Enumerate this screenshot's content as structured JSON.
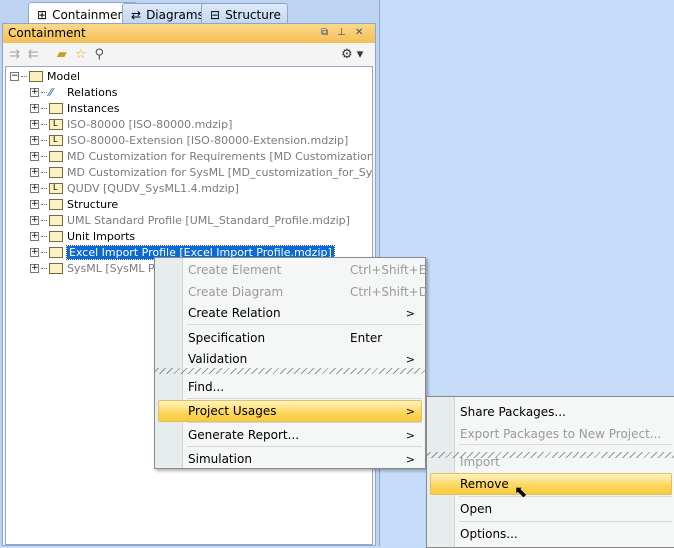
{
  "tabs": [
    {
      "label": "Containment",
      "icon": "containment-icon"
    },
    {
      "label": "Diagrams",
      "icon": "diagrams-icon"
    },
    {
      "label": "Structure",
      "icon": "structure-icon"
    }
  ],
  "panel": {
    "title": "Containment"
  },
  "tree": [
    {
      "label": "Model",
      "type": "model",
      "expanded": true,
      "level": 0
    },
    {
      "label": "Relations",
      "type": "relations",
      "level": 1
    },
    {
      "label": "Instances",
      "type": "folder",
      "level": 1
    },
    {
      "label": "ISO-80000 [ISO-80000.mdzip]",
      "type": "library",
      "level": 1,
      "gray": true
    },
    {
      "label": "ISO-80000-Extension [ISO-80000-Extension.mdzip]",
      "type": "library",
      "level": 1,
      "gray": true
    },
    {
      "label": "MD Customization for Requirements [MD Customization for Requ",
      "type": "shared",
      "level": 1,
      "gray": true
    },
    {
      "label": "MD Customization for SysML [MD_customization_for_SysML.mdzi",
      "type": "shared",
      "level": 1,
      "gray": true
    },
    {
      "label": "QUDV [QUDV_SysML1.4.mdzip]",
      "type": "library",
      "level": 1,
      "gray": true
    },
    {
      "label": "Structure",
      "type": "folder",
      "level": 1
    },
    {
      "label": "UML Standard Profile [UML_Standard_Profile.mdzip]",
      "type": "shared",
      "level": 1,
      "gray": true
    },
    {
      "label": "Unit Imports",
      "type": "folder",
      "level": 1
    },
    {
      "label": "Excel Import Profile [Excel Import Profile.mdzip]",
      "type": "profile",
      "level": 1,
      "selected": true
    },
    {
      "label": "SysML [SysML Profi",
      "type": "profile",
      "level": 1,
      "gray": true
    }
  ],
  "context_menu": [
    {
      "label": "Create Element",
      "shortcut": "Ctrl+Shift+E",
      "disabled": true
    },
    {
      "label": "Create Diagram",
      "shortcut": "Ctrl+Shift+D",
      "disabled": true
    },
    {
      "label": "Create Relation",
      "submenu": true
    },
    {
      "label": "Specification",
      "shortcut": "Enter"
    },
    {
      "label": "Validation",
      "submenu": true
    },
    {
      "label": "Find..."
    },
    {
      "label": "Project Usages",
      "submenu": true,
      "highlighted": true
    },
    {
      "label": "Generate Report...",
      "submenu": true
    },
    {
      "label": "Simulation",
      "submenu": true
    }
  ],
  "submenu": [
    {
      "label": "Share Packages..."
    },
    {
      "label": "Export Packages to New Project...",
      "disabled": true
    },
    {
      "label": "Import",
      "disabled": true
    },
    {
      "label": "Remove",
      "highlighted": true
    },
    {
      "label": "Open"
    },
    {
      "label": "Options..."
    }
  ],
  "arrow": ">"
}
